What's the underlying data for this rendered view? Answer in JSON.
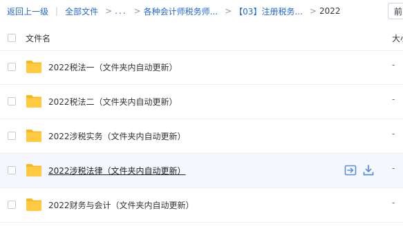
{
  "breadcrumb": {
    "back_label": "返回上一级",
    "all_files_label": "全部文件",
    "ellipsis": "...",
    "level1_label": "各种会计师税务师...",
    "level2_label": "【03】注册税务...",
    "current_label": "2022"
  },
  "top_right_button_label": "前",
  "header": {
    "name_label": "文件名",
    "size_label": "大小"
  },
  "files": [
    {
      "name": "2022税法一（文件夹内自动更新）",
      "size": "-"
    },
    {
      "name": "2022税法二（文件夹内自动更新）",
      "size": "-"
    },
    {
      "name": "2022涉税实务（文件夹内自动更新）",
      "size": "-"
    },
    {
      "name": "2022涉税法律（文件夹内自动更新）",
      "size": "-"
    },
    {
      "name": "2022财务与会计（文件夹内自动更新）",
      "size": "-"
    }
  ],
  "colors": {
    "link": "#2468d6",
    "folder": "#ffc940",
    "folder_tab": "#f5b823",
    "action_icon": "#5b8ed8",
    "hover_row": "#f4f8fe"
  },
  "hover_row_index": 3
}
